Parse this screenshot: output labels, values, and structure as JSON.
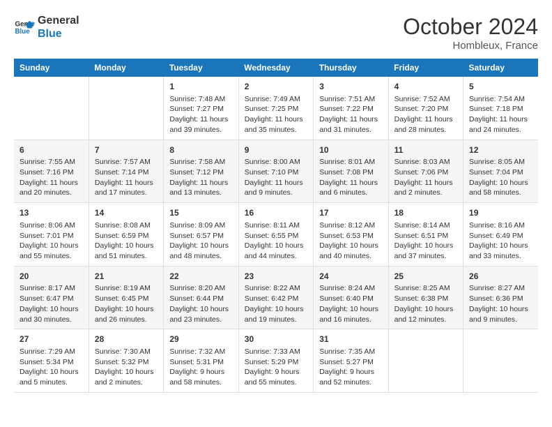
{
  "logo": {
    "line1": "General",
    "line2": "Blue"
  },
  "title": "October 2024",
  "location": "Hombleux, France",
  "days_header": [
    "Sunday",
    "Monday",
    "Tuesday",
    "Wednesday",
    "Thursday",
    "Friday",
    "Saturday"
  ],
  "weeks": [
    [
      {
        "num": "",
        "info": ""
      },
      {
        "num": "",
        "info": ""
      },
      {
        "num": "1",
        "info": "Sunrise: 7:48 AM\nSunset: 7:27 PM\nDaylight: 11 hours and 39 minutes."
      },
      {
        "num": "2",
        "info": "Sunrise: 7:49 AM\nSunset: 7:25 PM\nDaylight: 11 hours and 35 minutes."
      },
      {
        "num": "3",
        "info": "Sunrise: 7:51 AM\nSunset: 7:22 PM\nDaylight: 11 hours and 31 minutes."
      },
      {
        "num": "4",
        "info": "Sunrise: 7:52 AM\nSunset: 7:20 PM\nDaylight: 11 hours and 28 minutes."
      },
      {
        "num": "5",
        "info": "Sunrise: 7:54 AM\nSunset: 7:18 PM\nDaylight: 11 hours and 24 minutes."
      }
    ],
    [
      {
        "num": "6",
        "info": "Sunrise: 7:55 AM\nSunset: 7:16 PM\nDaylight: 11 hours and 20 minutes."
      },
      {
        "num": "7",
        "info": "Sunrise: 7:57 AM\nSunset: 7:14 PM\nDaylight: 11 hours and 17 minutes."
      },
      {
        "num": "8",
        "info": "Sunrise: 7:58 AM\nSunset: 7:12 PM\nDaylight: 11 hours and 13 minutes."
      },
      {
        "num": "9",
        "info": "Sunrise: 8:00 AM\nSunset: 7:10 PM\nDaylight: 11 hours and 9 minutes."
      },
      {
        "num": "10",
        "info": "Sunrise: 8:01 AM\nSunset: 7:08 PM\nDaylight: 11 hours and 6 minutes."
      },
      {
        "num": "11",
        "info": "Sunrise: 8:03 AM\nSunset: 7:06 PM\nDaylight: 11 hours and 2 minutes."
      },
      {
        "num": "12",
        "info": "Sunrise: 8:05 AM\nSunset: 7:04 PM\nDaylight: 10 hours and 58 minutes."
      }
    ],
    [
      {
        "num": "13",
        "info": "Sunrise: 8:06 AM\nSunset: 7:01 PM\nDaylight: 10 hours and 55 minutes."
      },
      {
        "num": "14",
        "info": "Sunrise: 8:08 AM\nSunset: 6:59 PM\nDaylight: 10 hours and 51 minutes."
      },
      {
        "num": "15",
        "info": "Sunrise: 8:09 AM\nSunset: 6:57 PM\nDaylight: 10 hours and 48 minutes."
      },
      {
        "num": "16",
        "info": "Sunrise: 8:11 AM\nSunset: 6:55 PM\nDaylight: 10 hours and 44 minutes."
      },
      {
        "num": "17",
        "info": "Sunrise: 8:12 AM\nSunset: 6:53 PM\nDaylight: 10 hours and 40 minutes."
      },
      {
        "num": "18",
        "info": "Sunrise: 8:14 AM\nSunset: 6:51 PM\nDaylight: 10 hours and 37 minutes."
      },
      {
        "num": "19",
        "info": "Sunrise: 8:16 AM\nSunset: 6:49 PM\nDaylight: 10 hours and 33 minutes."
      }
    ],
    [
      {
        "num": "20",
        "info": "Sunrise: 8:17 AM\nSunset: 6:47 PM\nDaylight: 10 hours and 30 minutes."
      },
      {
        "num": "21",
        "info": "Sunrise: 8:19 AM\nSunset: 6:45 PM\nDaylight: 10 hours and 26 minutes."
      },
      {
        "num": "22",
        "info": "Sunrise: 8:20 AM\nSunset: 6:44 PM\nDaylight: 10 hours and 23 minutes."
      },
      {
        "num": "23",
        "info": "Sunrise: 8:22 AM\nSunset: 6:42 PM\nDaylight: 10 hours and 19 minutes."
      },
      {
        "num": "24",
        "info": "Sunrise: 8:24 AM\nSunset: 6:40 PM\nDaylight: 10 hours and 16 minutes."
      },
      {
        "num": "25",
        "info": "Sunrise: 8:25 AM\nSunset: 6:38 PM\nDaylight: 10 hours and 12 minutes."
      },
      {
        "num": "26",
        "info": "Sunrise: 8:27 AM\nSunset: 6:36 PM\nDaylight: 10 hours and 9 minutes."
      }
    ],
    [
      {
        "num": "27",
        "info": "Sunrise: 7:29 AM\nSunset: 5:34 PM\nDaylight: 10 hours and 5 minutes."
      },
      {
        "num": "28",
        "info": "Sunrise: 7:30 AM\nSunset: 5:32 PM\nDaylight: 10 hours and 2 minutes."
      },
      {
        "num": "29",
        "info": "Sunrise: 7:32 AM\nSunset: 5:31 PM\nDaylight: 9 hours and 58 minutes."
      },
      {
        "num": "30",
        "info": "Sunrise: 7:33 AM\nSunset: 5:29 PM\nDaylight: 9 hours and 55 minutes."
      },
      {
        "num": "31",
        "info": "Sunrise: 7:35 AM\nSunset: 5:27 PM\nDaylight: 9 hours and 52 minutes."
      },
      {
        "num": "",
        "info": ""
      },
      {
        "num": "",
        "info": ""
      }
    ]
  ]
}
